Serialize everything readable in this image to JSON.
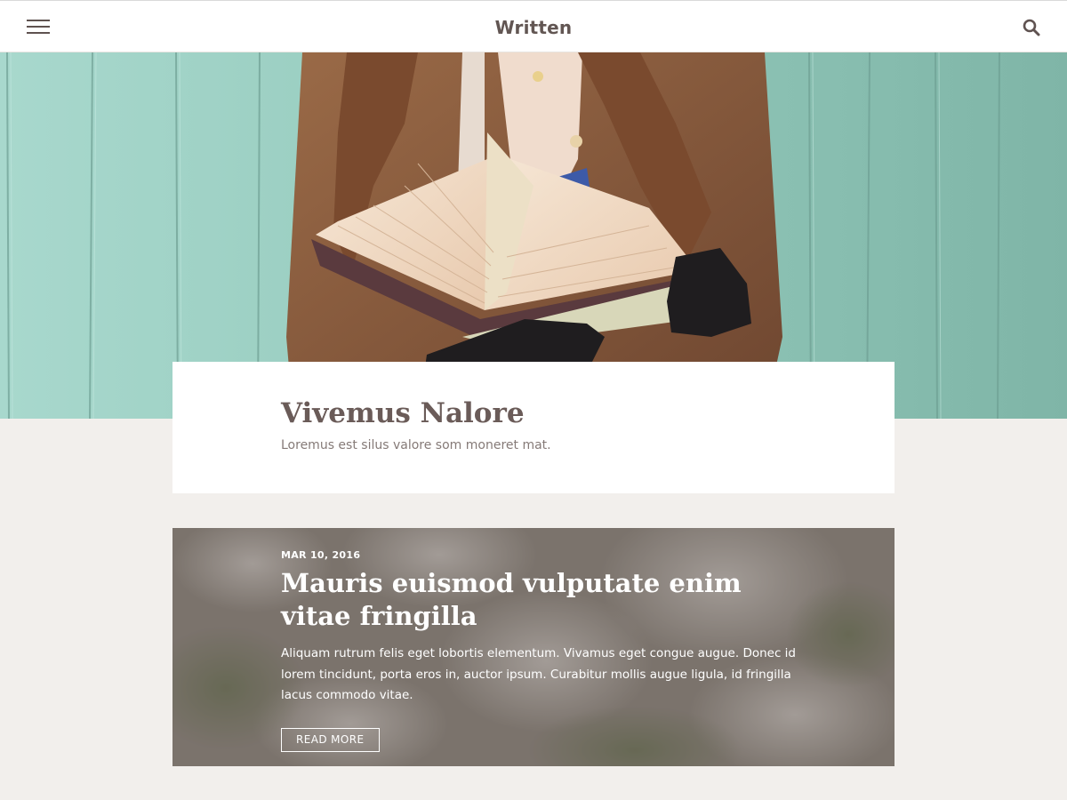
{
  "header": {
    "site_title": "Written",
    "menu_icon": "hamburger-menu-icon",
    "search_icon": "search-icon"
  },
  "hero": {
    "image": "woman-reading-book-photo",
    "colors": {
      "wall": "#8fc6b8",
      "jacket": "#8a5a3a",
      "hair": "#6a3f28"
    }
  },
  "intro": {
    "title": "Vivemus Nalore",
    "subtitle": "Loremus est silus valore som moneret mat."
  },
  "featured_post": {
    "date": "MAR 10, 2016",
    "title": "Mauris euismod vulputate enim vitae fringilla",
    "excerpt": "Aliquam rutrum felis eget lobortis elementum. Vivamus eget congue augue. Donec id lorem tincidunt, porta eros in, auctor ipsum. Curabitur mollis augue ligula, id fringilla lacus commodo vitae.",
    "read_more_label": "READ MORE",
    "image": "blossoms-photo"
  },
  "colors": {
    "page_bg": "#f2efec",
    "heading": "#6a5b58",
    "text_muted": "#857a77",
    "white": "#ffffff"
  }
}
